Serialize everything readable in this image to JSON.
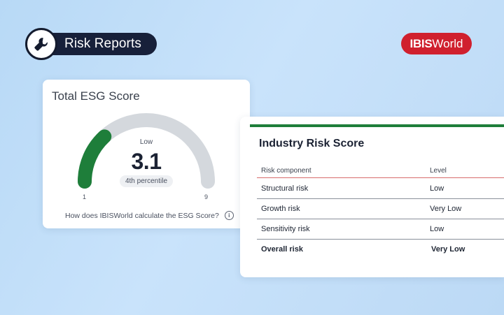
{
  "header": {
    "title": "Risk Reports",
    "icon": "wrench-icon"
  },
  "brand": {
    "part1": "IBIS",
    "part2": "World",
    "color": "#d0202e"
  },
  "esg": {
    "title": "Total ESG Score",
    "level": "Low",
    "score": "3.1",
    "percentile": "4th percentile",
    "min": "1",
    "max": "9",
    "gauge_value": 3.1,
    "gauge_min": 1,
    "gauge_max": 9,
    "fill_color": "#1e7e3a",
    "track_color": "#d4d8dd",
    "link": "How does IBISWorld calculate the ESG Score?"
  },
  "industry": {
    "title": "Industry Risk Score",
    "columns": [
      "Risk component",
      "Level"
    ],
    "rows": [
      {
        "component": "Structural risk",
        "level": "Low"
      },
      {
        "component": "Growth risk",
        "level": "Very Low"
      },
      {
        "component": "Sensitivity risk",
        "level": "Low"
      },
      {
        "component": "Overall risk",
        "level": "Very Low"
      }
    ]
  }
}
